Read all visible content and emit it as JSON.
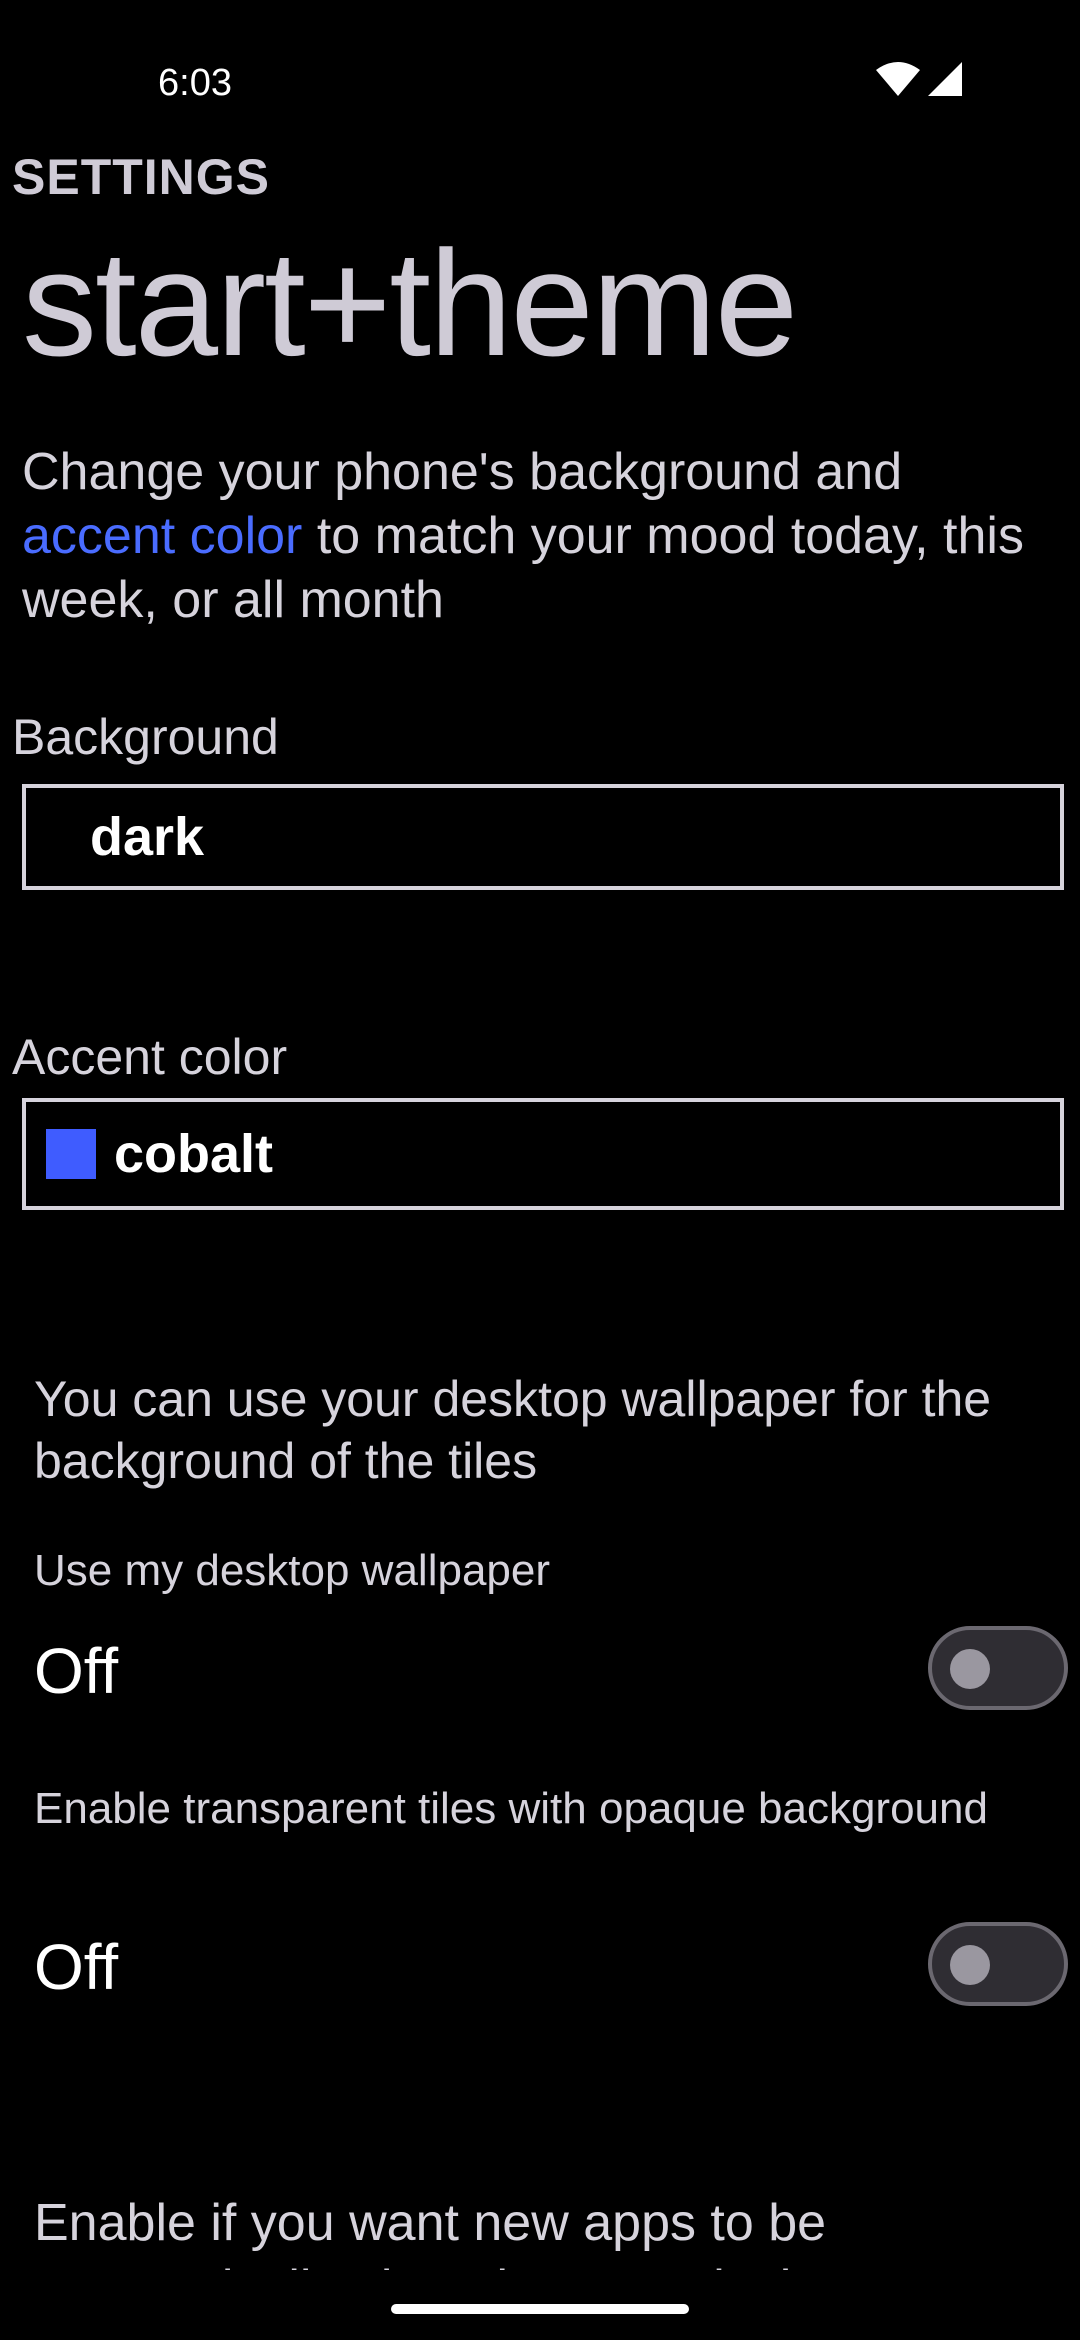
{
  "status_bar": {
    "time": "6:03",
    "icons": [
      "wifi-icon",
      "cellular-signal-icon"
    ]
  },
  "header": {
    "section_label": "SETTINGS",
    "title": "start+theme"
  },
  "description": {
    "part1": "Change your phone's background and ",
    "accent_link": "accent color",
    "part2": " to match your mood today, this week, or all month"
  },
  "background": {
    "label": "Background",
    "value": "dark"
  },
  "accent": {
    "label": "Accent color",
    "value": "cobalt",
    "swatch_color": "#3f5cff"
  },
  "wallpaper_info": "You can use your desktop wallpaper for the background of the tiles",
  "toggles": [
    {
      "label": "Use my desktop wallpaper",
      "state": "Off",
      "on": false
    },
    {
      "label": "Enable transparent tiles with opaque background",
      "state": "Off",
      "on": false
    }
  ],
  "footer_text": "Enable if you want new apps to be automatically pinned to your desktop",
  "colors": {
    "background": "#000000",
    "text": "#d6d3dc",
    "accent": "#4a6cff"
  }
}
